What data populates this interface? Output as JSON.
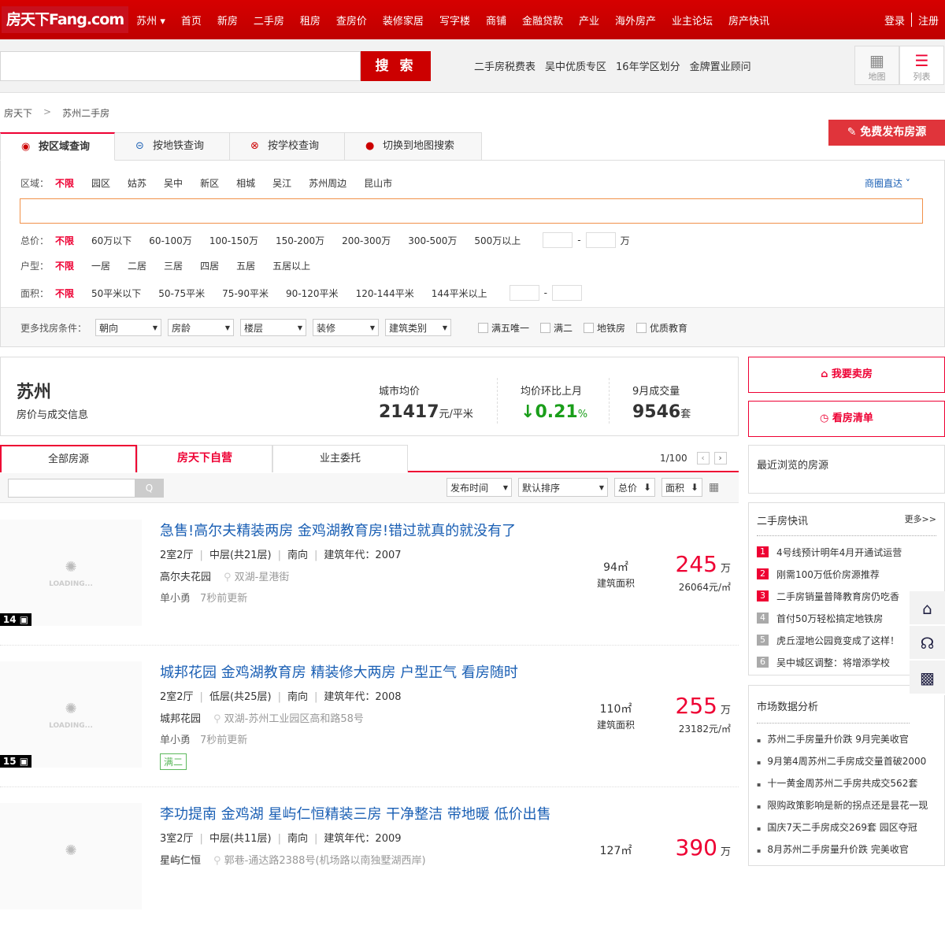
{
  "nav": {
    "logo": "房天下Fang.com",
    "city": "苏州",
    "items": [
      "首页",
      "新房",
      "二手房",
      "租房",
      "查房价",
      "装修家居",
      "写字楼",
      "商铺",
      "金融贷款",
      "产业",
      "海外房产",
      "业主论坛",
      "房产快讯"
    ],
    "login": "登录",
    "register": "注册"
  },
  "search": {
    "placeholder": "",
    "button": "搜 索",
    "hot": [
      "二手房税费表",
      "吴中优质专区",
      "16年学区划分",
      "金牌置业顾问"
    ],
    "view_map": "地图",
    "view_list": "列表"
  },
  "breadcrumb": [
    "房天下",
    ">",
    "苏州二手房"
  ],
  "publish": "免费发布房源",
  "query_tabs": [
    "按区域查询",
    "按地铁查询",
    "按学校查询",
    "切换到地图搜索"
  ],
  "filters": {
    "district": {
      "label": "区域：",
      "options": [
        "不限",
        "园区",
        "姑苏",
        "吴中",
        "新区",
        "相城",
        "吴江",
        "苏州周边",
        "昆山市"
      ],
      "extra": "商圈直达"
    },
    "price": {
      "label": "总价：",
      "options": [
        "不限",
        "60万以下",
        "60-100万",
        "100-150万",
        "150-200万",
        "200-300万",
        "300-500万",
        "500万以上"
      ],
      "unit": "万",
      "dash": "-"
    },
    "layout": {
      "label": "户型：",
      "options": [
        "不限",
        "一居",
        "二居",
        "三居",
        "四居",
        "五居",
        "五居以上"
      ]
    },
    "area": {
      "label": "面积：",
      "options": [
        "不限",
        "50平米以下",
        "50-75平米",
        "75-90平米",
        "90-120平米",
        "120-144平米",
        "144平米以上"
      ],
      "dash": "-"
    },
    "more": {
      "label": "更多找房条件：",
      "selects": [
        "朝向",
        "房龄",
        "楼层",
        "装修",
        "建筑类别"
      ],
      "checks": [
        "满五唯一",
        "满二",
        "地铁房",
        "优质教育"
      ]
    }
  },
  "stats": {
    "city": "苏州",
    "subtitle": "房价与成交信息",
    "avg_label": "城市均价",
    "avg_value": "21417",
    "avg_unit": "元/平米",
    "mom_label": "均价环比上月",
    "mom_arrow": "↓",
    "mom_value": "0.21",
    "mom_unit": "%",
    "deal_label": "9月成交量",
    "deal_value": "9546",
    "deal_unit": "套"
  },
  "side_buttons": {
    "sell": "我要卖房",
    "list": "看房清单"
  },
  "list_tabs": [
    "全部房源",
    "房天下自营",
    "业主委托"
  ],
  "pager": {
    "text": "1/100",
    "prev": "‹",
    "next": "›"
  },
  "toolbar": {
    "search_icon": "Q",
    "sorts": [
      "发布时间",
      "默认排序"
    ],
    "sort_total": "总价",
    "sort_area": "面积"
  },
  "listings": [
    {
      "title": "急售!高尔夫精装两房 金鸡湖教育房!错过就真的就没有了",
      "layout": "2室2厅",
      "floor": "中层(共21层)",
      "orient": "南向",
      "year": "建筑年代：2007",
      "community": "高尔夫花园",
      "address": "双湖-星港街",
      "agent": "单小勇",
      "updated": "7秒前更新",
      "area": "94㎡",
      "area_label": "建筑面积",
      "price": "245",
      "price_unit": "万",
      "unit_price": "26064元/㎡",
      "photos": "14",
      "loading": "LOADING..."
    },
    {
      "title": "城邦花园 金鸡湖教育房 精装修大两房 户型正气 看房随时",
      "layout": "2室2厅",
      "floor": "低层(共25层)",
      "orient": "南向",
      "year": "建筑年代：2008",
      "community": "城邦花园",
      "address": "双湖-苏州工业园区高和路58号",
      "agent": "单小勇",
      "updated": "7秒前更新",
      "tag": "满二",
      "area": "110㎡",
      "area_label": "建筑面积",
      "price": "255",
      "price_unit": "万",
      "unit_price": "23182元/㎡",
      "photos": "15",
      "loading": "LOADING..."
    },
    {
      "title": "李功提南 金鸡湖 星屿仁恒精装三房 干净整洁 带地暖 低价出售",
      "layout": "3室2厅",
      "floor": "中层(共11层)",
      "orient": "南向",
      "year": "建筑年代：2009",
      "community": "星屿仁恒",
      "address": "郭巷-通达路2388号(机场路以南独墅湖西岸)",
      "area": "127㎡",
      "price": "390",
      "price_unit": "万",
      "loading": ""
    }
  ],
  "recent": {
    "title": "最近浏览的房源"
  },
  "news": {
    "title": "二手房快讯",
    "more": "更多>>",
    "items": [
      "4号线预计明年4月开通试运营",
      "刚需100万低价房源推荐",
      "二手房销量普降教育房仍吃香",
      "首付50万轻松搞定地铁房",
      "虎丘湿地公园竟变成了这样！",
      "吴中城区调整：将增添学校"
    ]
  },
  "market": {
    "title": "市场数据分析",
    "items": [
      "苏州二手房量升价跌 9月完美收官",
      "9月第4周苏州二手房成交量首破2000",
      "十一黄金周苏州二手房共成交562套",
      "限购政策影响是新的拐点还是昙花一现",
      "国庆7天二手房成交269套 园区夺冠",
      "8月苏州二手房量升价跌 完美收官"
    ]
  }
}
